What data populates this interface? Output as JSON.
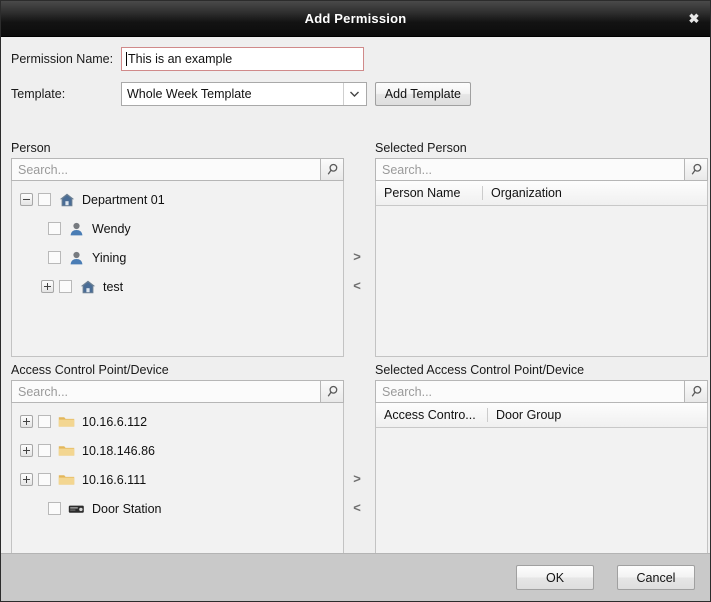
{
  "window": {
    "title": "Add Permission",
    "close_label": "✖"
  },
  "form": {
    "permission_name_label": "Permission Name:",
    "permission_name_value": "This is an example",
    "template_label": "Template:",
    "template_value": "Whole Week Template",
    "add_template_label": "Add Template"
  },
  "search": {
    "placeholder": "Search...",
    "icon": "search-icon"
  },
  "transfer": {
    "add_label": ">",
    "remove_label": "<"
  },
  "person_panel": {
    "title": "Person",
    "nodes": [
      {
        "label": "Department 01",
        "icon": "home-icon",
        "expander": "minus",
        "indent": 0,
        "checked": false
      },
      {
        "label": "Wendy",
        "icon": "person-icon",
        "expander": "none",
        "indent": 1,
        "checked": false
      },
      {
        "label": "Yining",
        "icon": "person-icon",
        "expander": "none",
        "indent": 1,
        "checked": false
      },
      {
        "label": "test",
        "icon": "home-icon",
        "expander": "plus",
        "indent": 0,
        "checked": false
      }
    ]
  },
  "selected_person_panel": {
    "title": "Selected Person",
    "columns": [
      "Person Name",
      "Organization"
    ],
    "rows": []
  },
  "device_panel": {
    "title": "Access Control Point/Device",
    "nodes": [
      {
        "label": "10.16.6.112",
        "icon": "folder-icon",
        "expander": "plus",
        "indent": 0,
        "checked": false
      },
      {
        "label": "10.18.146.86",
        "icon": "folder-icon",
        "expander": "plus",
        "indent": 0,
        "checked": false
      },
      {
        "label": "10.16.6.111",
        "icon": "folder-icon",
        "expander": "plus",
        "indent": 0,
        "checked": false
      },
      {
        "label": "Door Station",
        "icon": "door-station-icon",
        "expander": "none",
        "indent": 1,
        "checked": false
      }
    ]
  },
  "selected_device_panel": {
    "title": "Selected Access Control Point/Device",
    "columns": [
      "Access Contro...",
      "Door Group"
    ],
    "rows": []
  },
  "footer": {
    "ok_label": "OK",
    "cancel_label": "Cancel"
  },
  "colors": {
    "titlebar_start": "#4a4a4a",
    "titlebar_end": "#0c0c0c",
    "input_focus_border": "#d08a8a",
    "dialog_bg": "#efefef",
    "footer_bg": "#c9c9c9",
    "folder_icon": "#e8c36a",
    "person_icon": "#5b86b5"
  }
}
